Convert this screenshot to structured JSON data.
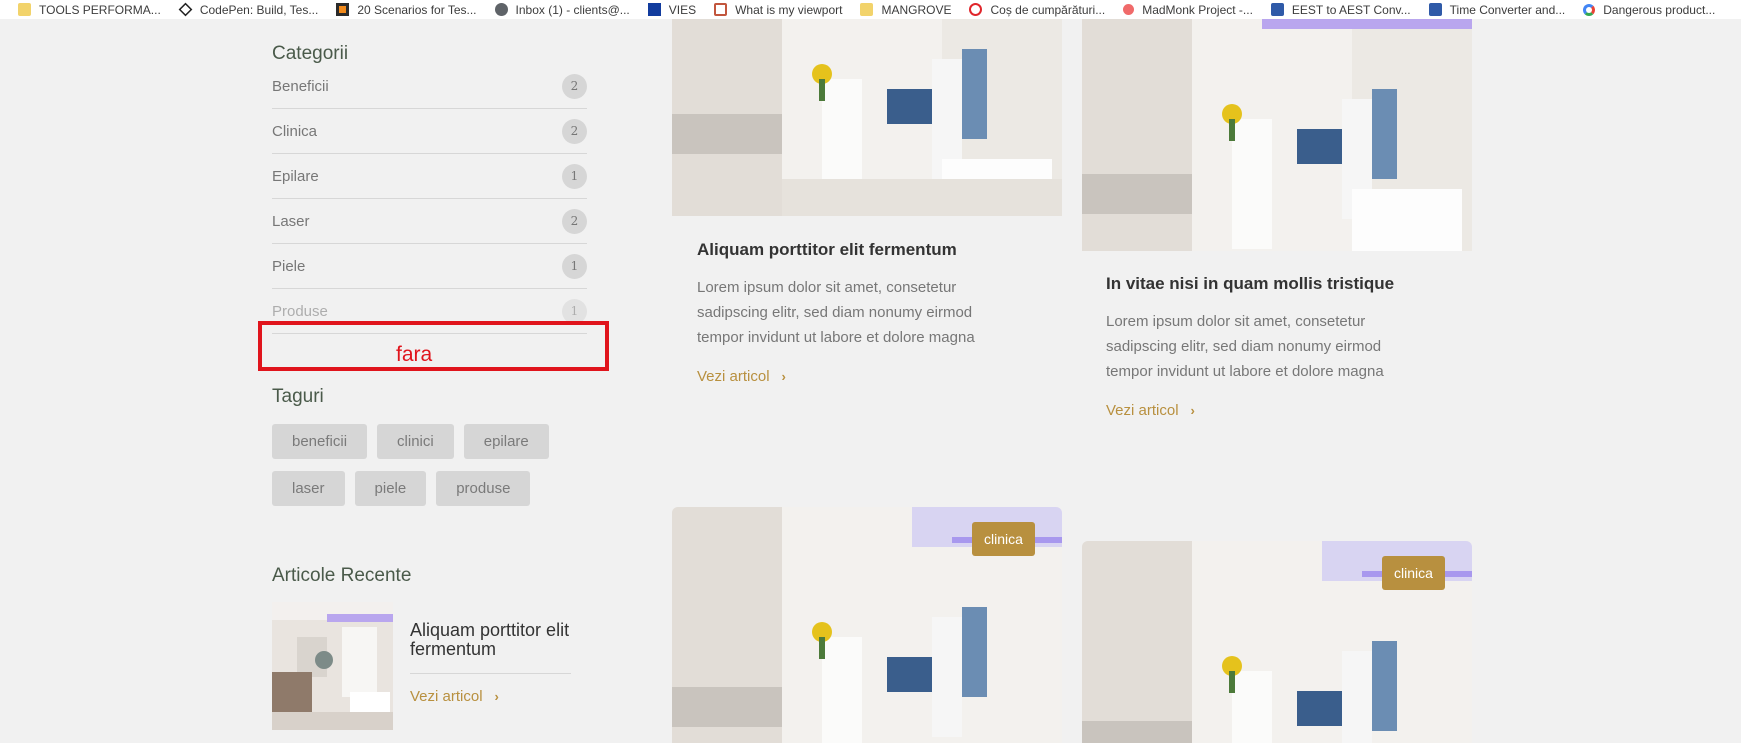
{
  "bookmarks": [
    {
      "label": "TOOLS PERFORMA...",
      "icon": "folder-icon"
    },
    {
      "label": "CodePen: Build, Tes...",
      "icon": "codepen-icon"
    },
    {
      "label": "20 Scenarios for Tes...",
      "icon": "scenarios-icon"
    },
    {
      "label": "Inbox (1) - clients@...",
      "icon": "globe-icon"
    },
    {
      "label": "VIES",
      "icon": "eu-flag-icon"
    },
    {
      "label": "What is my viewport",
      "icon": "viewport-icon"
    },
    {
      "label": "MANGROVE",
      "icon": "folder-icon"
    },
    {
      "label": "Coș de cumpărături...",
      "icon": "power-icon"
    },
    {
      "label": "MadMonk Project -...",
      "icon": "asana-icon"
    },
    {
      "label": "EEST to AEST Conv...",
      "icon": "timeanddate-icon"
    },
    {
      "label": "Time Converter and...",
      "icon": "timeanddate-icon"
    },
    {
      "label": "Dangerous product...",
      "icon": "google-icon"
    }
  ],
  "sidebar": {
    "categories_title": "Categorii",
    "categories": [
      {
        "name": "Beneficii",
        "count": "2"
      },
      {
        "name": "Clinica",
        "count": "2"
      },
      {
        "name": "Epilare",
        "count": "1"
      },
      {
        "name": "Laser",
        "count": "2"
      },
      {
        "name": "Piele",
        "count": "1"
      },
      {
        "name": "Produse",
        "count": "1"
      }
    ],
    "tags_title": "Taguri",
    "tags": [
      "beneficii",
      "clinici",
      "epilare",
      "laser",
      "piele",
      "produse"
    ],
    "recent_title": "Articole Recente",
    "recent": {
      "title": "Aliquam porttitor elit fermentum",
      "link": "Vezi articol"
    }
  },
  "annotation": {
    "text": "fara",
    "color": "#e0141c"
  },
  "posts": [
    {
      "title": "Aliquam porttitor elit fermentum",
      "excerpt": "Lorem ipsum dolor sit amet, consetetur sadipscing elitr, sed diam nonumy eirmod tempor invidunt ut labore et dolore magna",
      "link": "Vezi articol"
    },
    {
      "title": "In vitae nisi in quam mollis tristique",
      "excerpt": "Lorem ipsum dolor sit amet, consetetur sadipscing elitr, sed diam nonumy eirmod tempor invidunt ut labore et dolore magna",
      "link": "Vezi articol"
    },
    {
      "badge": "clinica"
    },
    {
      "badge": "clinica"
    }
  ],
  "colors": {
    "accent": "#b8903f",
    "background": "#f1f1f1",
    "annotation": "#e0141c"
  }
}
